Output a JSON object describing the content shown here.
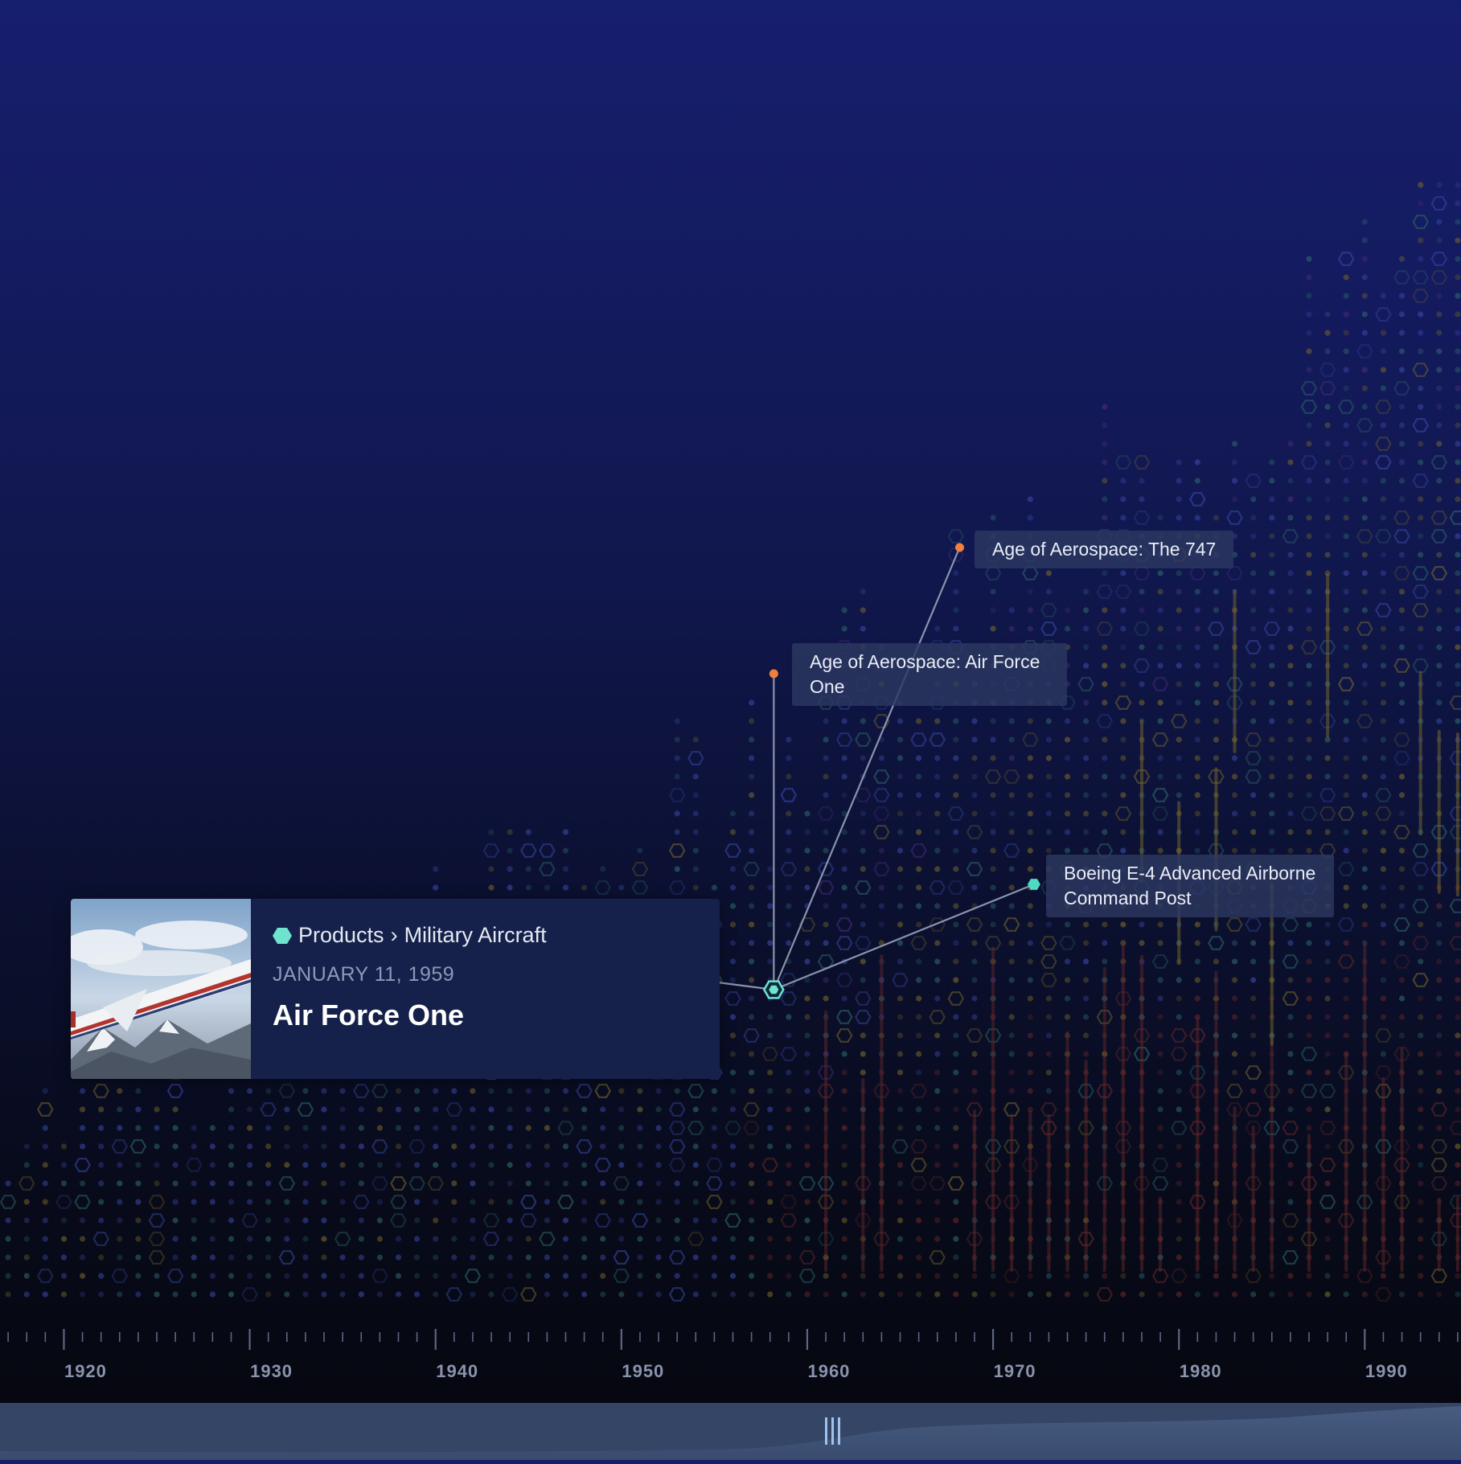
{
  "chart_data": {
    "type": "timeline",
    "x_axis": {
      "range": [
        1916,
        1996
      ],
      "tick_labels": [
        "1920",
        "1930",
        "1940",
        "1950",
        "1960",
        "1970",
        "1980",
        "1990"
      ]
    },
    "events": [
      {
        "label": "Age of Aerospace: The 747",
        "year": 1968,
        "marker_color": "#f0803c"
      },
      {
        "label": "Age of Aerospace: Air Force One",
        "year": 1958,
        "marker_color": "#f0803c"
      },
      {
        "label": "Boeing E-4 Advanced Airborne Command Post",
        "year": 1972,
        "marker_color": "#4fd8c4"
      }
    ],
    "selected": {
      "category": "Products",
      "subcategory": "Military Aircraft",
      "date": "JANUARY 11, 1959",
      "title": "Air Force One",
      "marker_color": "#6fe3cf"
    },
    "category_colors": [
      "#3b4aa8",
      "#2f6b6b",
      "#7a6a2c",
      "#6b2a2a",
      "#4a2d7a"
    ],
    "grid": false
  }
}
